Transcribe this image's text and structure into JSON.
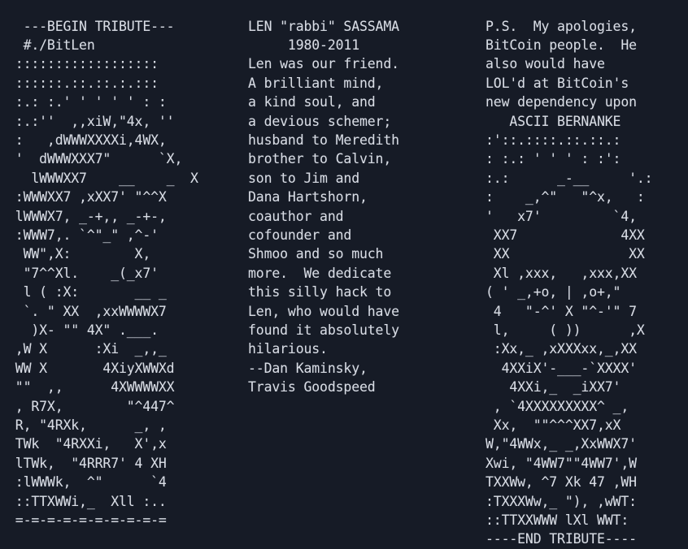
{
  "terminal": {
    "background_color": "#161b26",
    "text_color": "#d9dde5",
    "font_size_px": 16.5,
    "line_height_px": 23.4,
    "columns": 3
  },
  "left_column": {
    "name": "bitlen-ascii-art",
    "begin_marker": "---BEGIN TRIBUTE---",
    "command": "#./BitLen",
    "text": "  ---BEGIN TRIBUTE---\n  #./BitLen\n ::::::::::::::::::\n ::::::.::.::.:.:::\n :.: :.' ' ' ' ' : :\n :.:''  ,,xiW,\"4x, ''\n :   ,dWWWXXXXi,4WX,\n '  dWWWXXX7\"      `X,\n   lWWWXX7    __    _  X\n :WWWXX7 ,xXX7' \"^^X\n lWWWX7, _-+,, _-+-,\n :WWW7,. `^\"_\" ,^-'\n  WW\",X:        X,\n  \"7^^Xl.    _(_x7'\n  l ( :X:       __ _\n  `. \" XX  ,xxWWWWX7\n   )X- \"\" 4X\" .___.\n ,W X      :Xi  _,,_\n WW X       4XiyXWWXd\n \"\"  ,,      4XWWWWXX\n , R7X,        \"^447^\n R, \"4RXk,      _, ,\n TWk  \"4RXXi,   X',x\n lTWk,  \"4RRR7' 4 XH\n :lWWWk,  ^\"      `4\n ::TTXWWi,_  Xll :..\n =-=-=-=-=-=-=-=-=-="
  },
  "middle_column": {
    "name": "memorial-text",
    "heading": "LEN \"rabbi\" SASSAMA",
    "years": "1980-2011",
    "text": "LEN \"rabbi\" SASSAMA\n     1980-2011\nLen was our friend.\nA brilliant mind,\na kind soul, and\na devious schemer;\nhusband to Meredith\nbrother to Calvin,\nson to Jim and\nDana Hartshorn,\ncoauthor and\ncofounder and\nShmoo and so much\nmore.  We dedicate\nthis silly hack to\nLen, who would have\nfound it absolutely\nhilarious.\n--Dan Kaminsky,\nTravis Goodspeed",
    "signature_1": "--Dan Kaminsky,",
    "signature_2": "Travis Goodspeed"
  },
  "right_column": {
    "name": "postscript-and-bernanke-art",
    "heading": "ASCII BERNANKE",
    "end_marker": "----END TRIBUTE----",
    "text": "P.S.  My apologies,\nBitCoin people.  He\nalso would have\nLOL'd at BitCoin's\nnew dependency upon\n   ASCII BERNANKE\n:'::.::::.::.::.:\n: :.: ' ' ' : :':\n:.:      _-__     '.:\n:    _,^\"   \"^x,   :\n'   x7'         `4,\n XX7             4XX\n XX               XX\n Xl ,xxx,   ,xxx,XX\n( ' _,+o, | ,o+,\"\n 4   \"-^' X \"^-'\" 7\n l,     ( ))      ,X\n :Xx,_ ,xXXXxx,_,XX\n  4XXiX'-___-`XXXX'\n   4XXi,_  _iXX7'\n , `4XXXXXXXXX^ _,\n Xx,  \"\"^^^XX7,xX\nW,\"4WWx,_ _,XxWWX7'\nXwi, \"4WW7\"\"4WW7',W\nTXXWw, ^7 Xk 47 ,WH\n:TXXXWw,_ \"), ,wWT:\n::TTXXWWW lXl WWT:\n----END TRIBUTE----"
  }
}
